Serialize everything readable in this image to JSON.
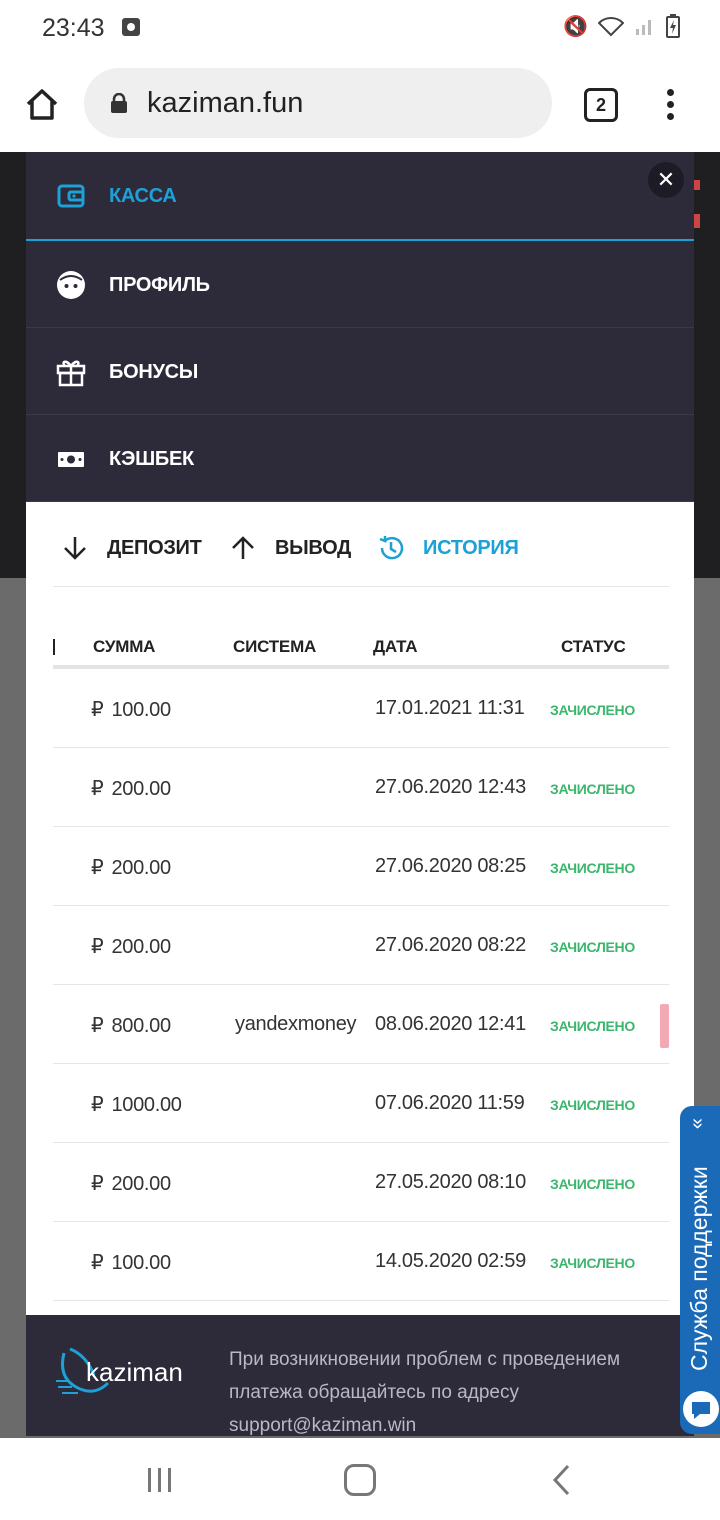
{
  "status_bar": {
    "time": "23:43"
  },
  "browser": {
    "url": "kaziman.fun",
    "tab_count": "2"
  },
  "menu": {
    "items": [
      {
        "label": "КАССА",
        "active": true
      },
      {
        "label": "ПРОФИЛЬ",
        "active": false
      },
      {
        "label": "БОНУСЫ",
        "active": false
      },
      {
        "label": "КЭШБЕК",
        "active": false
      }
    ],
    "close_label": "✕"
  },
  "tabs": [
    {
      "label": "ДЕПОЗИТ",
      "active": false
    },
    {
      "label": "ВЫВОД",
      "active": false
    },
    {
      "label": "ИСТОРИЯ",
      "active": true
    }
  ],
  "table": {
    "headers": {
      "sum": "СУММА",
      "system": "СИСТЕМА",
      "date": "ДАТА",
      "status": "СТАТУС"
    },
    "currency": "₽",
    "rows": [
      {
        "sum": "100.00",
        "system": "",
        "date": "17.01.2021 11:31",
        "status": "ЗАЧИСЛЕНО"
      },
      {
        "sum": "200.00",
        "system": "",
        "date": "27.06.2020 12:43",
        "status": "ЗАЧИСЛЕНО"
      },
      {
        "sum": "200.00",
        "system": "",
        "date": "27.06.2020 08:25",
        "status": "ЗАЧИСЛЕНО"
      },
      {
        "sum": "200.00",
        "system": "",
        "date": "27.06.2020 08:22",
        "status": "ЗАЧИСЛЕНО"
      },
      {
        "sum": "800.00",
        "system": "yandexmoney",
        "date": "08.06.2020 12:41",
        "status": "ЗАЧИСЛЕНО"
      },
      {
        "sum": "1000.00",
        "system": "",
        "date": "07.06.2020 11:59",
        "status": "ЗАЧИСЛЕНО"
      },
      {
        "sum": "200.00",
        "system": "",
        "date": "27.05.2020 08:10",
        "status": "ЗАЧИСЛЕНО"
      },
      {
        "sum": "100.00",
        "system": "",
        "date": "14.05.2020 02:59",
        "status": "ЗАЧИСЛЕНО"
      }
    ]
  },
  "footer": {
    "logo_text": "kaziman",
    "message": "При возникновении проблем с проведением платежа обращайтесь по адресу support@kaziman.win"
  },
  "support": {
    "label": "Служба поддержки",
    "arrows": "«"
  },
  "colors": {
    "accent": "#1da1d6",
    "menu_bg": "#2d2b3a",
    "status_ok": "#3bb66c",
    "support_bg": "#1a6ab8"
  }
}
